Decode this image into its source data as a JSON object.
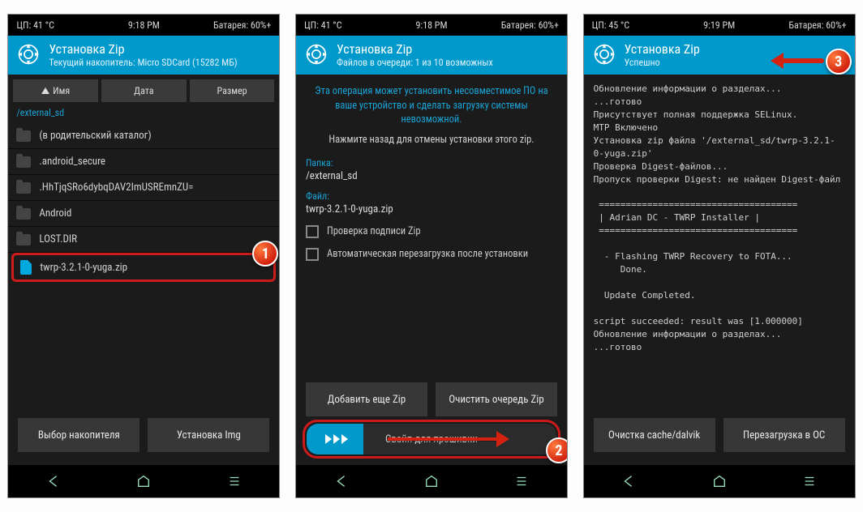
{
  "screen1": {
    "status": {
      "cpu": "ЦП: 41 °C",
      "time": "9:18 PM",
      "battery": "Батарея: 60%+"
    },
    "header": {
      "title": "Установка Zip",
      "sub": "Текущий накопитель: Micro SDCard (15282 МБ)"
    },
    "sort": {
      "name": "Имя",
      "date": "Дата",
      "size": "Размер"
    },
    "path": "/external_sd",
    "files": {
      "up": "(в родительский каталог)",
      "f1": ".android_secure",
      "f2": ".HhTjqSRo6dybqDAV2ImUSREmnZU=",
      "f3": "Android",
      "f4": "LOST.DIR",
      "zip": "twrp-3.2.1-0-yuga.zip"
    },
    "buttons": {
      "storage": "Выбор накопителя",
      "img": "Установка Img"
    }
  },
  "screen2": {
    "status": {
      "cpu": "ЦП: 41 °C",
      "time": "9:18 PM",
      "battery": "Батарея: 60%+"
    },
    "header": {
      "title": "Установка Zip",
      "sub": "Файлов в очереди: 1 из 10 возможных"
    },
    "warning": "Эта операция может установить несовместимое ПО на ваше устройство и сделать загрузку системы невозможной.",
    "hint": "Нажмите назад для отмены установки этого zip.",
    "folder_label": "Папка:",
    "folder_value": "/external_sd",
    "file_label": "Файл:",
    "file_value": "twrp-3.2.1-0-yuga.zip",
    "chk_sig": "Проверка подписи Zip",
    "chk_reboot": "Автоматическая перезагрузка после установки",
    "buttons": {
      "add": "Добавить еще Zip",
      "clear": "Очистить очередь Zip"
    },
    "swipe": "Свайп для прошивки"
  },
  "screen3": {
    "status": {
      "cpu": "ЦП: 45 °C",
      "time": "9:19 PM",
      "battery": "Батарея: 60%+"
    },
    "header": {
      "title": "Установка Zip",
      "sub": "Успешно"
    },
    "console": "Обновление информации о разделах...\n...готово\nПрисутствует полная поддержка SELinux.\nMTP Включено\nУстановка zip файла '/external_sd/twrp-3.2.1-0-yuga.zip'\nПроверка Digest-файлов...\nПропуск проверки Digest: не найден Digest-файл\n\n =====================================\n | Adrian DC - TWRP Installer |\n =====================================\n\n  - Flashing TWRP Recovery to FOTA...\n     Done.\n\n  Update Completed.\n\nscript succeeded: result was [1.000000]\nОбновление информации о разделах...\n...готово",
    "buttons": {
      "wipe": "Очистка cache/dalvik",
      "reboot": "Перезагрузка в ОС"
    }
  },
  "badges": {
    "b1": "1",
    "b2": "2",
    "b3": "3"
  }
}
